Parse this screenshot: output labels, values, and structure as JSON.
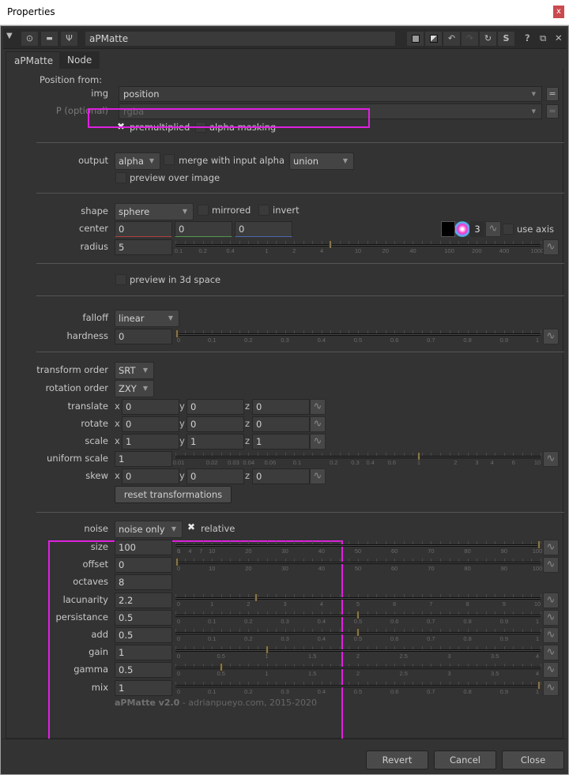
{
  "window": {
    "title": "Properties",
    "close_label": "x"
  },
  "nodebar": {
    "collapse_icon": "▼",
    "node_name": "aPMatte",
    "left_icons": [
      "viewer-icon",
      "input-icon",
      "wrench-icon"
    ],
    "right_icons": [
      "color-swatch-icon",
      "mask-icon",
      "undo-icon",
      "redo-icon",
      "revert-icon",
      "s-icon",
      "help-icon",
      "float-icon",
      "close-icon"
    ],
    "help": "?",
    "float": "⧉",
    "close": "✕",
    "s": "S"
  },
  "tabs": [
    {
      "label": "aPMatte",
      "active": true
    },
    {
      "label": "Node",
      "active": false
    }
  ],
  "position": {
    "heading": "Position from:",
    "img_label": "img",
    "img_value": "position",
    "p_label": "P (optional)",
    "p_value": "rgba",
    "premultiplied_label": "premultiplied",
    "premultiplied": true,
    "alpha_masking_label": "alpha masking",
    "alpha_masking": false,
    "eq": "="
  },
  "output": {
    "label": "output",
    "value": "alpha",
    "merge_label": "merge with input alpha",
    "merge": false,
    "merge_mode": "union",
    "preview_label": "preview over image",
    "preview": false
  },
  "shape": {
    "label": "shape",
    "value": "sphere",
    "mirrored_label": "mirrored",
    "mirrored": false,
    "invert_label": "invert",
    "invert": false,
    "center_label": "center",
    "center": [
      "0",
      "0",
      "0"
    ],
    "channel_count": "3",
    "use_axis_label": "use axis",
    "use_axis": false,
    "radius_label": "radius",
    "radius": "5",
    "radius_ticks": [
      "0.1",
      "0.2",
      "0.4",
      "1",
      "2",
      "4",
      "10",
      "20",
      "40",
      "100",
      "200",
      "400",
      "1000"
    ],
    "preview3d_label": "preview in 3d space",
    "preview3d": false
  },
  "falloff": {
    "label": "falloff",
    "value": "linear",
    "hardness_label": "hardness",
    "hardness": "0",
    "hardness_ticks": [
      "0",
      "0.1",
      "0.2",
      "0.3",
      "0.4",
      "0.5",
      "0.6",
      "0.7",
      "0.8",
      "0.9",
      "1"
    ]
  },
  "transform": {
    "order_label": "transform order",
    "order": "SRT",
    "rot_order_label": "rotation order",
    "rot_order": "ZXY",
    "rows": [
      {
        "label": "translate",
        "x": "0",
        "y": "0",
        "z": "0"
      },
      {
        "label": "rotate",
        "x": "0",
        "y": "0",
        "z": "0"
      },
      {
        "label": "scale",
        "x": "1",
        "y": "1",
        "z": "1"
      }
    ],
    "uniform_label": "uniform scale",
    "uniform": "1",
    "uniform_ticks": [
      "0.01",
      "0.02",
      "0.03",
      "0.04",
      "0.06",
      "0.1",
      "0.2",
      "0.3",
      "0.4",
      "0.6",
      "1",
      "2",
      "3",
      "4",
      "6",
      "10"
    ],
    "skew": {
      "label": "skew",
      "x": "0",
      "y": "0",
      "z": "0"
    },
    "axis_x": "x",
    "axis_y": "y",
    "axis_z": "z",
    "reset_label": "reset transformations"
  },
  "noise": {
    "label": "noise",
    "value": "noise only",
    "relative_label": "relative",
    "relative": true,
    "params": [
      {
        "label": "size",
        "value": "100",
        "slider_fraction": 1.0,
        "ticks": [
          "0",
          "1",
          "4",
          "7",
          "10",
          "20",
          "30",
          "40",
          "50",
          "60",
          "70",
          "80",
          "90",
          "100"
        ]
      },
      {
        "label": "offset",
        "value": "0",
        "slider_fraction": 0.0,
        "ticks": [
          "0",
          "10",
          "20",
          "30",
          "40",
          "50",
          "60",
          "70",
          "80",
          "90",
          "100"
        ]
      },
      {
        "label": "octaves",
        "value": "8"
      },
      {
        "label": "lacunarity",
        "value": "2.2",
        "slider_fraction": 0.22,
        "ticks": [
          "0",
          "1",
          "2",
          "3",
          "4",
          "5",
          "6",
          "7",
          "8",
          "9",
          "10"
        ]
      },
      {
        "label": "persistance",
        "value": "0.5",
        "slider_fraction": 0.5,
        "ticks": [
          "0",
          "0.1",
          "0.2",
          "0.3",
          "0.4",
          "0.5",
          "0.6",
          "0.7",
          "0.8",
          "0.9",
          "1"
        ]
      },
      {
        "label": "add",
        "value": "0.5",
        "slider_fraction": 0.5,
        "ticks": [
          "0",
          "0.1",
          "0.2",
          "0.3",
          "0.4",
          "0.5",
          "0.6",
          "0.7",
          "0.8",
          "0.9",
          "1"
        ]
      },
      {
        "label": "gain",
        "value": "1",
        "slider_fraction": 0.25,
        "ticks": [
          "0",
          "0.5",
          "1",
          "1.5",
          "2",
          "2.5",
          "3",
          "3.5",
          "4"
        ]
      },
      {
        "label": "gamma",
        "value": "0.5",
        "slider_fraction": 0.125,
        "ticks": [
          "0",
          "0.5",
          "1",
          "1.5",
          "2",
          "2.5",
          "3",
          "3.5",
          "4"
        ]
      },
      {
        "label": "mix",
        "value": "1",
        "slider_fraction": 1.0,
        "ticks": [
          "0",
          "0.1",
          "0.2",
          "0.3",
          "0.4",
          "0.5",
          "0.6",
          "0.7",
          "0.8",
          "0.9",
          "1"
        ]
      }
    ]
  },
  "credit": {
    "name": "aPMatte v2.0",
    "rest": " - adrianpueyo.com, 2015-2020"
  },
  "footer": {
    "revert": "Revert",
    "cancel": "Cancel",
    "close": "Close"
  },
  "colors": {
    "highlight": "#e020e0",
    "handle": "#857550",
    "close_button": "#c94a4f"
  }
}
